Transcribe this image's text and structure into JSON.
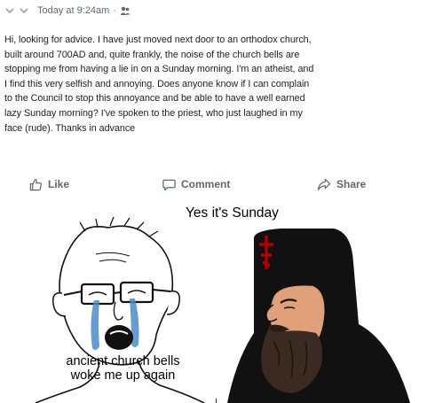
{
  "post": {
    "timestamp": "Today at 9:24am",
    "separator": "·",
    "audience_icon": "friends-icon",
    "body": "Hi, looking for advice. I have just moved next door to an orthodox church, built around 700AD and, quite frankly, the noise of the church bells are stopping me from having a lie in on a Sunday morning. I'm an atheist, and I find this very selfish and annoying. Does anyone know if I can complain to the Council to stop this annoyance and be able to have a well earned lazy Sunday morning? I've spoken to the priest, who just laughed in my face (rude). Thanks in advance",
    "body_lines": [
      "Hi, looking for advice. I have just moved next door to an orthodox church,",
      "built around 700AD and, quite frankly, the noise of the church bells are",
      "stopping me from having a lie in on a Sunday morning. I'm an atheist, and",
      "I find this very selfish and annoying. Does anyone know if I can complain",
      "to the Council to stop this annoyance and be able to have a well earned",
      "lazy Sunday morning? I've spoken to the priest, who just laughed in my",
      "face (rude). Thanks in advance"
    ]
  },
  "actions": {
    "like": "Like",
    "comment": "Comment",
    "share": "Share"
  },
  "meme": {
    "top_text": "Yes it's Sunday",
    "caption_line1": "ancient church bells",
    "caption_line2": "woke me up again"
  },
  "colors": {
    "text": "#1c1e21",
    "secondary": "#606770",
    "beard": "#3a2a22",
    "skin": "#e0a07a",
    "robe": "#111111",
    "cross": "#b00000",
    "tears": "#4a8bc9"
  }
}
